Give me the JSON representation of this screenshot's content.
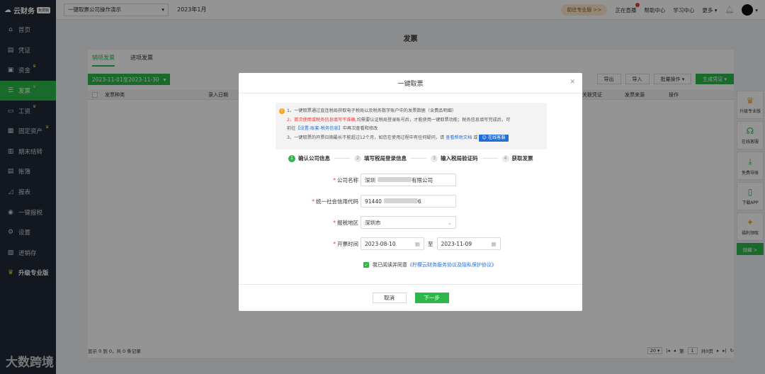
{
  "app": {
    "logo": "云财务",
    "logo_badge": "免费版"
  },
  "sidebar": {
    "items": [
      {
        "label": "首页",
        "icon": "home-icon",
        "glyph": "⌂"
      },
      {
        "label": "凭证",
        "icon": "voucher-icon",
        "glyph": "▤"
      },
      {
        "label": "资金",
        "icon": "fund-icon",
        "glyph": "▣",
        "crown": true
      },
      {
        "label": "发票",
        "icon": "invoice-icon",
        "glyph": "☰",
        "crown": true,
        "active": true
      },
      {
        "label": "工资",
        "icon": "salary-icon",
        "glyph": "▭",
        "crown": true
      },
      {
        "label": "固定资产",
        "icon": "asset-icon",
        "glyph": "▦",
        "crown": true
      },
      {
        "label": "期末结转",
        "icon": "closing-icon",
        "glyph": "▥"
      },
      {
        "label": "账簿",
        "icon": "ledger-icon",
        "glyph": "▤"
      },
      {
        "label": "报表",
        "icon": "report-icon",
        "glyph": "◿"
      },
      {
        "label": "一键报税",
        "icon": "tax-icon",
        "glyph": "◉"
      },
      {
        "label": "设置",
        "icon": "settings-icon",
        "glyph": "⚙"
      },
      {
        "label": "进销存",
        "icon": "inventory-icon",
        "glyph": "▧"
      }
    ],
    "upgrade_label": "升级专业版"
  },
  "watermark": "大数跨境",
  "topbar": {
    "company": "一键取票公司操作演示",
    "period": "2023年1月",
    "pro_button": "前往专业版 >>",
    "links": [
      "正在直播",
      "帮助中心",
      "学习中心"
    ],
    "more": "更多"
  },
  "page": {
    "title": "发票",
    "tabs": [
      "销项发票",
      "进项发票"
    ],
    "date_range": "2023-11-01至2023-11-30",
    "toolbar": [
      "导出",
      "导入",
      "批量操作",
      "生成凭证"
    ],
    "columns": [
      "发票种类",
      "录入日期",
      "关联凭证",
      "发票来源",
      "操作"
    ],
    "pager_text": "显示 0 到 0，共 0 条记录",
    "page_size": "20",
    "page_prefix": "第",
    "page_no": "1",
    "page_total": "共0页"
  },
  "float_panel": {
    "items": [
      {
        "label": "升级专业版",
        "icon": "crown-icon",
        "glyph": "♛"
      },
      {
        "label": "在线客服",
        "icon": "headset-icon",
        "glyph": "☊"
      },
      {
        "label": "免费导账",
        "icon": "download-icon",
        "glyph": "⤓"
      },
      {
        "label": "下载APP",
        "icon": "phone-icon",
        "glyph": "▯"
      },
      {
        "label": "福利领取",
        "icon": "gift-icon",
        "glyph": "✦"
      }
    ],
    "hide_label": "隐藏 >"
  },
  "modal": {
    "title": "一键取票",
    "notice": {
      "line1": "1、一键取票通过直连税局获取电子税局以及税务数字账户中的发票数据（含费品明细）",
      "line2_red": "2、首次使用或税务信息填写不准确,",
      "line2_rest": "均需要认证税局登录账号后，才能使用一键取票功能；税务信息填写完成后，可",
      "line3_prefix": "前往",
      "line3_link": "【设置-账套-税务信息】",
      "line3_rest": "中再次查看和修改",
      "line4": "3、一键取票的开票日期最长不能超过12个月，如您在使用过程中有任何疑问，请",
      "line4_link": "查看帮助文档",
      "line4_or": "或",
      "service_button": "在线客服"
    },
    "steps": [
      {
        "num": "1",
        "label": "确认公司信息"
      },
      {
        "num": "2",
        "label": "填写税局登录信息"
      },
      {
        "num": "3",
        "label": "输入税局验证码"
      },
      {
        "num": "4",
        "label": "获取发票"
      }
    ],
    "fields": {
      "company_label": "公司名称",
      "company_value": "深圳",
      "company_tail": "有限公司",
      "credit_label": "统一社会信用代码",
      "credit_value": "91440",
      "credit_tail": "6",
      "region_label": "报税地区",
      "region_value": "深圳市",
      "date_label": "开票时间",
      "date_from": "2023-08-10",
      "date_to_label": "至",
      "date_to": "2023-11-09"
    },
    "agree_prefix": "我已阅读并同意",
    "agree_link": "《柠檬云财务服务协议及隐私保护协议》",
    "cancel": "取消",
    "next": "下一步"
  }
}
